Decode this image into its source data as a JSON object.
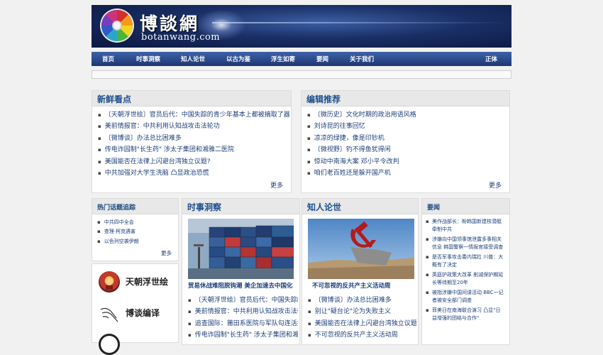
{
  "site": {
    "title": "博談網",
    "domain": "botanwang.com"
  },
  "nav": [
    {
      "label": "首页"
    },
    {
      "label": "时事洞察"
    },
    {
      "label": "知人论世"
    },
    {
      "label": "以古为鉴"
    },
    {
      "label": "浮生如寄"
    },
    {
      "label": "要闻"
    },
    {
      "label": "关于我们"
    },
    {
      "label": "正体"
    }
  ],
  "fresh": {
    "title": "新鲜看点",
    "items": [
      "〔天朝浮世绘〕官员后代：中国失踪的青少年基本上都被摘取了器官",
      "美前情报官：中共利用认知战攻击法轮功",
      "〔微博谈〕办法总比困难多",
      "传电诈园制\"长生药\" 涉太子集团和湘雅二医院",
      "美国能否在法律上闪避台湾独立议题?",
      "中共加强对大学生洗脑 凸显政治恐慌"
    ],
    "more": "更多"
  },
  "editor": {
    "title": "编辑推荐",
    "items": [
      "〔微历史〕文化时期的政治用语风格",
      "刘诗昆的往事回忆",
      "凉凉的绿捷，像是印钞机",
      "〔微视野〕钓不得鱼犹得闲",
      "惊动中南海大案 邓小平令改判",
      "咱们老百姓还是躲开国产机"
    ],
    "more": "更多"
  },
  "hot": {
    "title": "热门话题追踪",
    "items": [
      "中共四中全会",
      "查理·柯克遇害",
      "以色列空袭伊朗"
    ],
    "more": "更多"
  },
  "columns": [
    {
      "name": "天朝浮世绘",
      "icon": "face-icon"
    },
    {
      "name": "博谈编译",
      "icon": "writing-hand-icon"
    }
  ],
  "shishi": {
    "title": "时事洞察",
    "caption": "贸易休战难阻脱钩潮 美企加速去中国化",
    "items": [
      "〔天朝浮世绘〕官员后代：中国失踪的青少年基本上都被摘取了器官",
      "美前情报官：中共利用认知战攻击法轮功",
      "追查国际：莆田系医院与军队勾连活摘器官",
      "传电诈园制\"长生药\" 涉太子集团和湘雅二医院"
    ]
  },
  "zhiren": {
    "title": "知人论世",
    "caption": "不可忽视的反共产主义活动周",
    "items": [
      "〔微博谈〕办法总比困难多",
      "别让\"疑台论\"沦为失败主义",
      "美国能否在法律上闪避台湾独立议题?",
      "不可忽视的反共产主义活动周"
    ]
  },
  "yaowen": {
    "title": "要闻",
    "items": [
      "美作战部长：盼韩国新建核潜艇牵制中共",
      "涉嫌向中国领事馆泄露多事相关信息 韩国警察一情报官接受调查",
      "是否军事攻击委内瑞拉 川普：大概有了决定",
      "英庭护政策大改革 削减保护期延长等待期至20年",
      "被指涉嫌中国间谍活动 BBC一记者被安全部门调查",
      "菲美日在南海联合演习 凸显\"日益增强的团结与合作\""
    ]
  },
  "colors": {
    "brand": "#1e4f8c",
    "nav": "#2a4b8e",
    "link": "#1d3f7a"
  }
}
